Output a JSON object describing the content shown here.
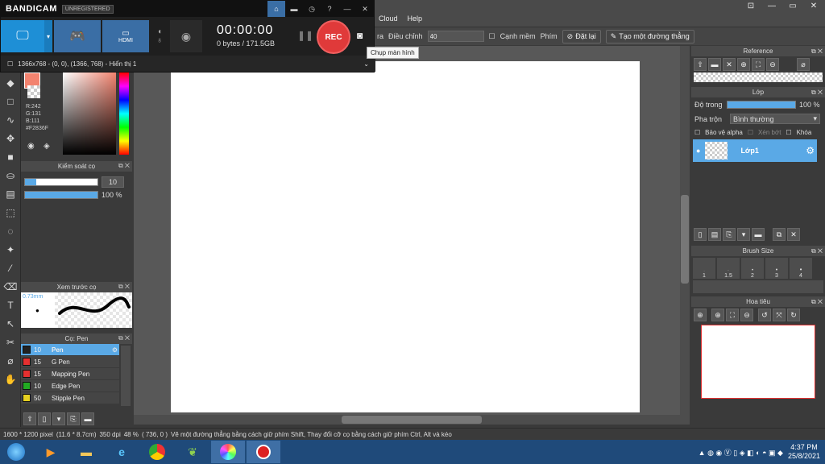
{
  "menubar": {
    "items": [
      "Cloud",
      "Help"
    ],
    "window_controls": [
      "⊡",
      "—",
      "▭",
      "✕"
    ]
  },
  "toolbar": {
    "partial_label": "ra",
    "adjust_label": "Điều chỉnh",
    "adjust_value": "40",
    "edge_label": "Cạnh mềm",
    "key_label": "Phím",
    "reset_label": "Đặt lại",
    "straight_label": "Tạo một đường thẳng"
  },
  "bandicam": {
    "logo": "BANDICAM",
    "badge": "UNREGISTERED",
    "timer": "00:00:00",
    "size": "0 bytes / 171.5GB",
    "rec_label": "REC",
    "hdmi_label": "HDMI",
    "status": "1366x768 - (0, 0), (1366, 768) - Hiển thị 1",
    "tooltip": "Chụp màn hình"
  },
  "color": {
    "r": "R:242",
    "g": "G:131",
    "b": "B:111",
    "hex": "#F2836F"
  },
  "brush_control": {
    "title": "Kiểm soát cọ",
    "size_value": "10",
    "opacity_value": "100 %",
    "size_level": 0.15,
    "opacity_level": 1.0
  },
  "brush_preview": {
    "title": "Xem trước cọ",
    "size": "0.73mm"
  },
  "brush_list": {
    "title": "Cọ: Pen",
    "items": [
      {
        "size": "10",
        "name": "Pen",
        "color": "#222222"
      },
      {
        "size": "15",
        "name": "G Pen",
        "color": "#e53030"
      },
      {
        "size": "15",
        "name": "Mapping Pen",
        "color": "#e53030"
      },
      {
        "size": "10",
        "name": "Edge Pen",
        "color": "#22aa22"
      },
      {
        "size": "50",
        "name": "Stipple Pen",
        "color": "#e6d020"
      }
    ]
  },
  "reference": {
    "title": "Reference"
  },
  "layers": {
    "title": "Lớp",
    "opacity_label": "Độ trong",
    "opacity_value": "100 %",
    "blend_label": "Pha trộn",
    "blend_value": "Bình thường",
    "protect_alpha": "Bảo vệ alpha",
    "clip": "Xén bớt",
    "lock": "Khóa",
    "layer_name": "Lớp1"
  },
  "brush_size": {
    "title": "Brush Size",
    "sizes": [
      "1",
      "1.5",
      "2",
      "3",
      "4"
    ]
  },
  "navigator": {
    "title": "Hoa tiêu"
  },
  "status": {
    "dims": "1600 * 1200 pixel",
    "cm": "(11.6 * 8.7cm)",
    "dpi": "350 dpi",
    "zoom": "48 %",
    "coords": "( 736, 0 )",
    "hint": "Vẽ một đường thẳng bằng cách giữ phím Shift, Thay đổi cỡ cọ bằng cách giữ phím Ctrl, Alt và kéo"
  },
  "taskbar": {
    "time": "4:37 PM",
    "date": "25/8/2021"
  }
}
